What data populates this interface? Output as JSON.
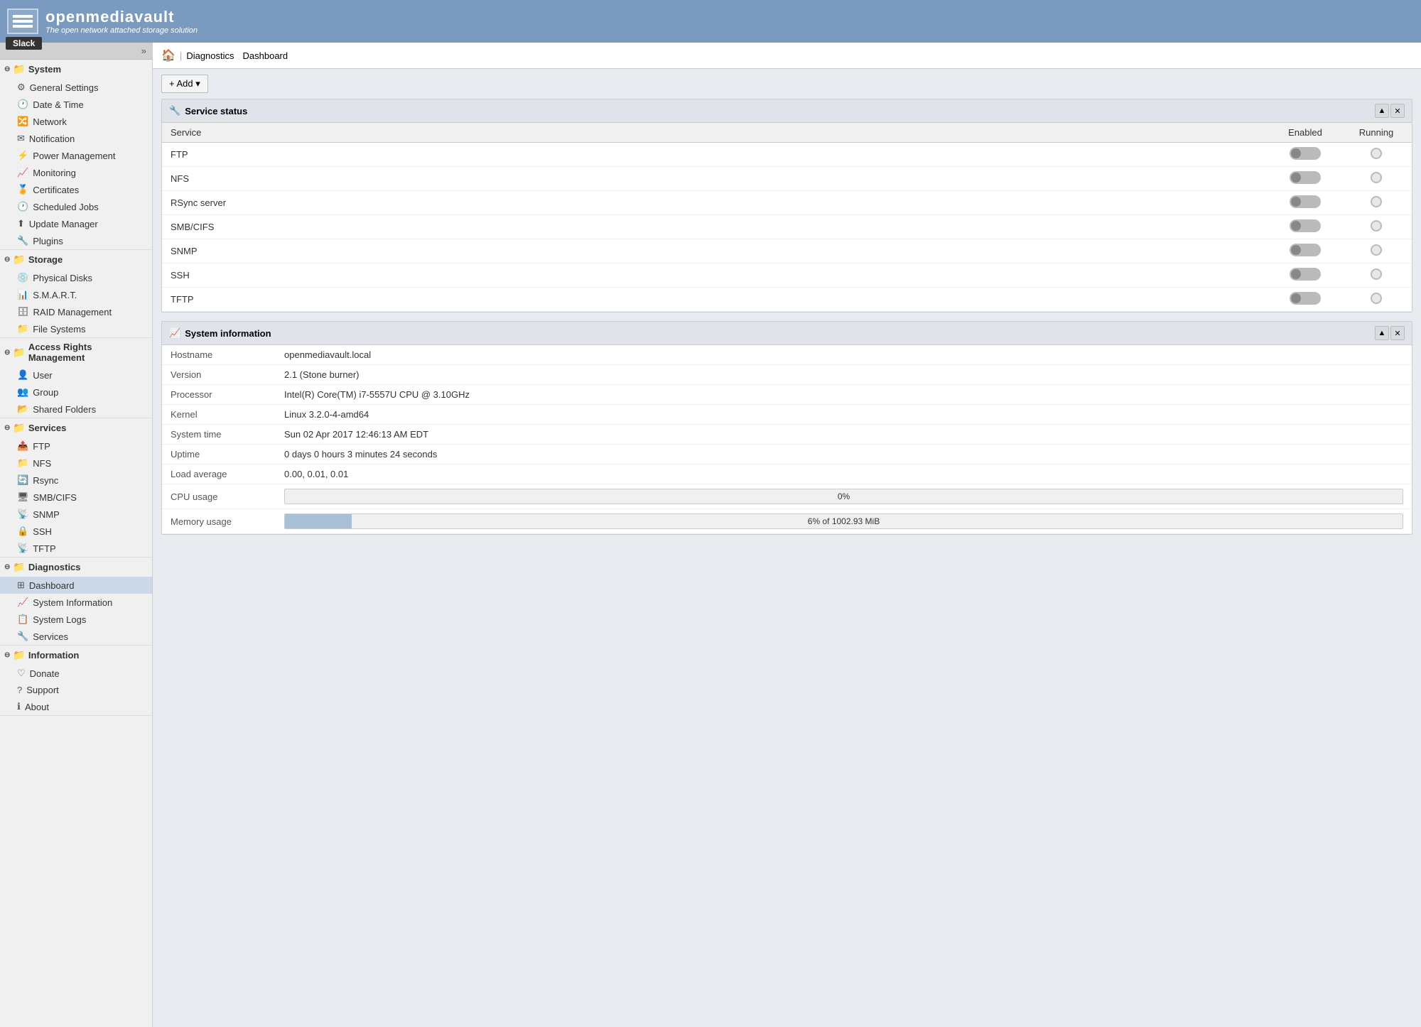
{
  "header": {
    "app_name": "openmediavault",
    "tagline": "The open network attached storage solution",
    "slack_badge": "Slack"
  },
  "breadcrumb": {
    "home_label": "🏠",
    "sep": "|",
    "items": [
      "Diagnostics",
      "Dashboard"
    ]
  },
  "toolbar": {
    "add_label": "+ Add ▾"
  },
  "sidebar": {
    "collapse_icon": "»",
    "sections": [
      {
        "name": "System",
        "items": [
          {
            "icon": "⚙",
            "label": "General Settings"
          },
          {
            "icon": "🕐",
            "label": "Date & Time"
          },
          {
            "icon": "🔀",
            "label": "Network"
          },
          {
            "icon": "✉",
            "label": "Notification"
          },
          {
            "icon": "⚡",
            "label": "Power Management"
          },
          {
            "icon": "📈",
            "label": "Monitoring"
          },
          {
            "icon": "🏅",
            "label": "Certificates"
          },
          {
            "icon": "🕐",
            "label": "Scheduled Jobs"
          },
          {
            "icon": "⬆",
            "label": "Update Manager"
          },
          {
            "icon": "🔧",
            "label": "Plugins"
          }
        ]
      },
      {
        "name": "Storage",
        "items": [
          {
            "icon": "💿",
            "label": "Physical Disks"
          },
          {
            "icon": "📊",
            "label": "S.M.A.R.T."
          },
          {
            "icon": "🗄",
            "label": "RAID Management"
          },
          {
            "icon": "📁",
            "label": "File Systems"
          }
        ]
      },
      {
        "name": "Access Rights Management",
        "items": [
          {
            "icon": "👤",
            "label": "User"
          },
          {
            "icon": "👥",
            "label": "Group"
          },
          {
            "icon": "📂",
            "label": "Shared Folders"
          }
        ]
      },
      {
        "name": "Services",
        "items": [
          {
            "icon": "📤",
            "label": "FTP"
          },
          {
            "icon": "📁",
            "label": "NFS"
          },
          {
            "icon": "🔄",
            "label": "Rsync"
          },
          {
            "icon": "🖥",
            "label": "SMB/CIFS"
          },
          {
            "icon": "📡",
            "label": "SNMP"
          },
          {
            "icon": "🔒",
            "label": "SSH"
          },
          {
            "icon": "📡",
            "label": "TFTP"
          }
        ]
      },
      {
        "name": "Diagnostics",
        "items": [
          {
            "icon": "⊞",
            "label": "Dashboard",
            "active": true
          },
          {
            "icon": "📈",
            "label": "System Information"
          },
          {
            "icon": "📋",
            "label": "System Logs"
          },
          {
            "icon": "🔧",
            "label": "Services"
          }
        ]
      },
      {
        "name": "Information",
        "items": [
          {
            "icon": "♡",
            "label": "Donate"
          },
          {
            "icon": "?",
            "label": "Support"
          },
          {
            "icon": "ℹ",
            "label": "About"
          }
        ]
      }
    ]
  },
  "service_status_panel": {
    "title": "Service status",
    "title_icon": "🔧",
    "col_service": "Service",
    "col_enabled": "Enabled",
    "col_running": "Running",
    "rows": [
      {
        "name": "FTP"
      },
      {
        "name": "NFS"
      },
      {
        "name": "RSync server"
      },
      {
        "name": "SMB/CIFS"
      },
      {
        "name": "SNMP"
      },
      {
        "name": "SSH"
      },
      {
        "name": "TFTP"
      }
    ]
  },
  "system_info_panel": {
    "title": "System information",
    "title_icon": "📈",
    "rows": [
      {
        "label": "Hostname",
        "value": "openmediavault.local"
      },
      {
        "label": "Version",
        "value": "2.1 (Stone burner)"
      },
      {
        "label": "Processor",
        "value": "Intel(R) Core(TM) i7-5557U CPU @ 3.10GHz"
      },
      {
        "label": "Kernel",
        "value": "Linux 3.2.0-4-amd64"
      },
      {
        "label": "System time",
        "value": "Sun 02 Apr 2017 12:46:13 AM EDT"
      },
      {
        "label": "Uptime",
        "value": "0 days 0 hours 3 minutes 24 seconds"
      },
      {
        "label": "Load average",
        "value": "0.00, 0.01, 0.01"
      }
    ],
    "cpu_label": "CPU usage",
    "cpu_value": "0%",
    "cpu_percent": 0,
    "mem_label": "Memory usage",
    "mem_value": "6% of 1002.93 MiB",
    "mem_percent": 6
  }
}
